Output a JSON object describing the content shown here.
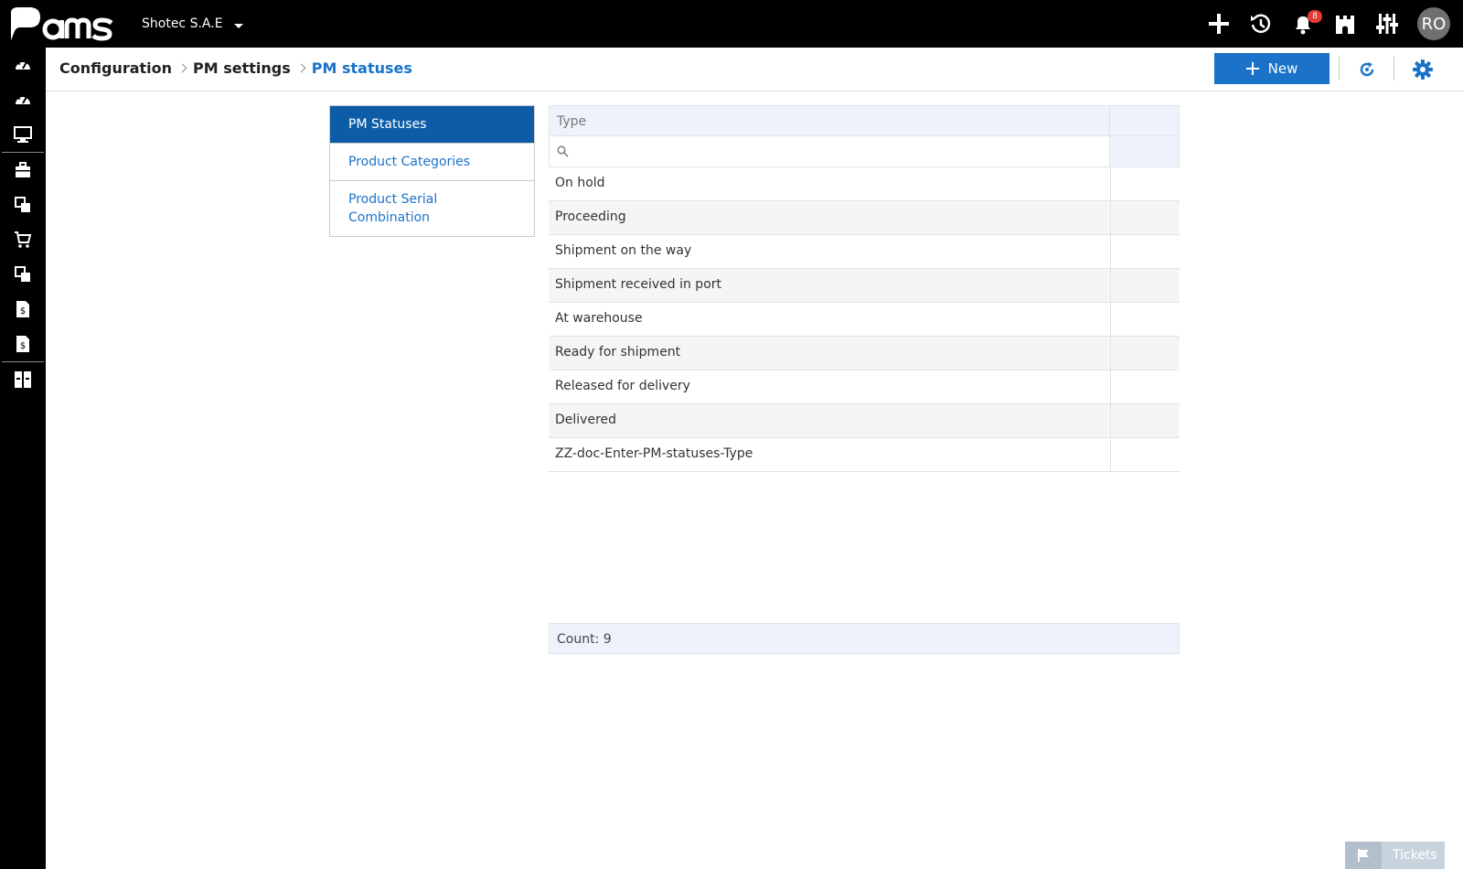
{
  "app": {
    "logo_text": "Pams"
  },
  "topbar": {
    "company": "Shotec S.A.E",
    "notifications_count": "8",
    "avatar_initials": "RO"
  },
  "header": {
    "breadcrumb": [
      "Configuration",
      "PM settings",
      "PM statuses"
    ],
    "new_button_label": "New"
  },
  "settings_menu": {
    "items": [
      "PM Statuses",
      "Product Categories",
      "Product Serial Combination"
    ],
    "active_index": 0
  },
  "grid": {
    "column_header": "Type",
    "rows": [
      "On hold",
      "Proceeding",
      "Shipment on the way",
      "Shipment received in port",
      "At warehouse",
      "Ready for shipment",
      "Released for delivery",
      "Delivered",
      "ZZ-doc-Enter-PM-statuses-Type"
    ],
    "count_label": "Count: 9"
  },
  "tickets": {
    "label": "Tickets"
  },
  "colors": {
    "accent": "#1a73c9",
    "active_menu": "#0d5ca8",
    "badge": "#e53935"
  }
}
